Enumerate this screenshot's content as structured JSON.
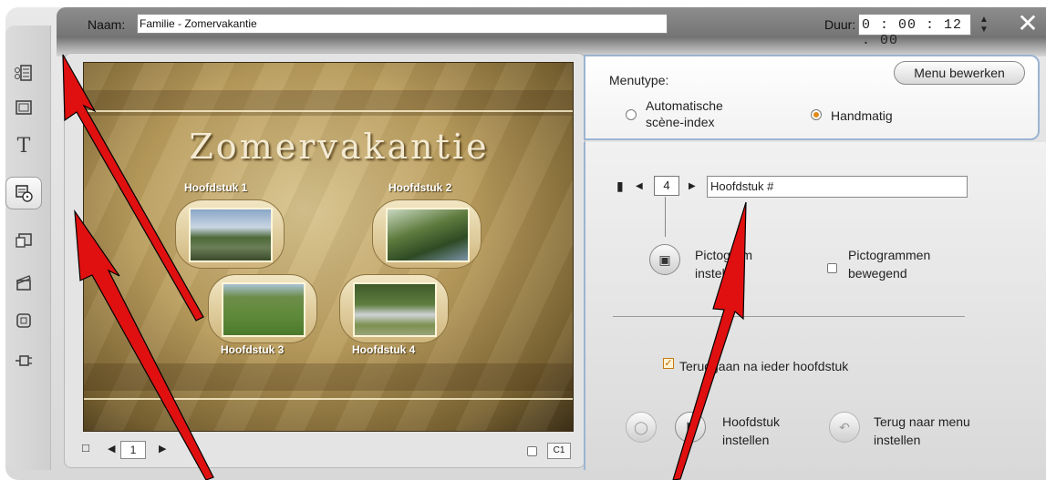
{
  "header": {
    "name_label": "Naam:",
    "name_value": "Familie - Zomervakantie",
    "duration_label": "Duur:",
    "duration_value": "0 : 00 : 12 . 00",
    "close_glyph": "✕"
  },
  "sidebar": {
    "tools": [
      {
        "icon": "video-clip-icon"
      },
      {
        "icon": "image-frame-icon"
      },
      {
        "icon": "title-text-icon"
      },
      {
        "icon": "disc-menu-icon",
        "active": true
      },
      {
        "icon": "transition-icon"
      },
      {
        "icon": "clapperboard-icon"
      },
      {
        "icon": "square-overlay-icon"
      },
      {
        "icon": "audio-plug-icon"
      }
    ],
    "title_tool_glyph": "T"
  },
  "preview": {
    "menu_title": "Zomervakantie",
    "chapters": [
      "Hoofdstuk 1",
      "Hoofdstuk 2",
      "Hoofdstuk 3",
      "Hoofdstuk 4"
    ],
    "page_number": "1",
    "c1_label": "C1"
  },
  "menutype": {
    "label": "Menutype:",
    "edit_button": "Menu bewerken",
    "option_auto": "Automatische scène-index",
    "option_auto_line1": "Automatische",
    "option_auto_line2": "scène-index",
    "option_manual": "Handmatig",
    "selected": "Handmatig"
  },
  "chapter_panel": {
    "chapter_number": "4",
    "chapter_name": "Hoofdstuk #",
    "set_thumbnail_line1": "Pictogram",
    "set_thumbnail_line2": "instellen",
    "animated_thumbs_line1": "Pictogrammen",
    "animated_thumbs_line2": "bewegend",
    "return_after_chapter": "Teruggaan na ieder hoofdstuk",
    "set_chapter_line1": "Hoofdstuk",
    "set_chapter_line2": "instellen",
    "set_return_line1": "Terug naar menu",
    "set_return_line2": "instellen"
  },
  "colors": {
    "annotation_arrow": "#e01010",
    "panel_border": "#9ab4d2",
    "radio_selected": "#e08a1a"
  }
}
